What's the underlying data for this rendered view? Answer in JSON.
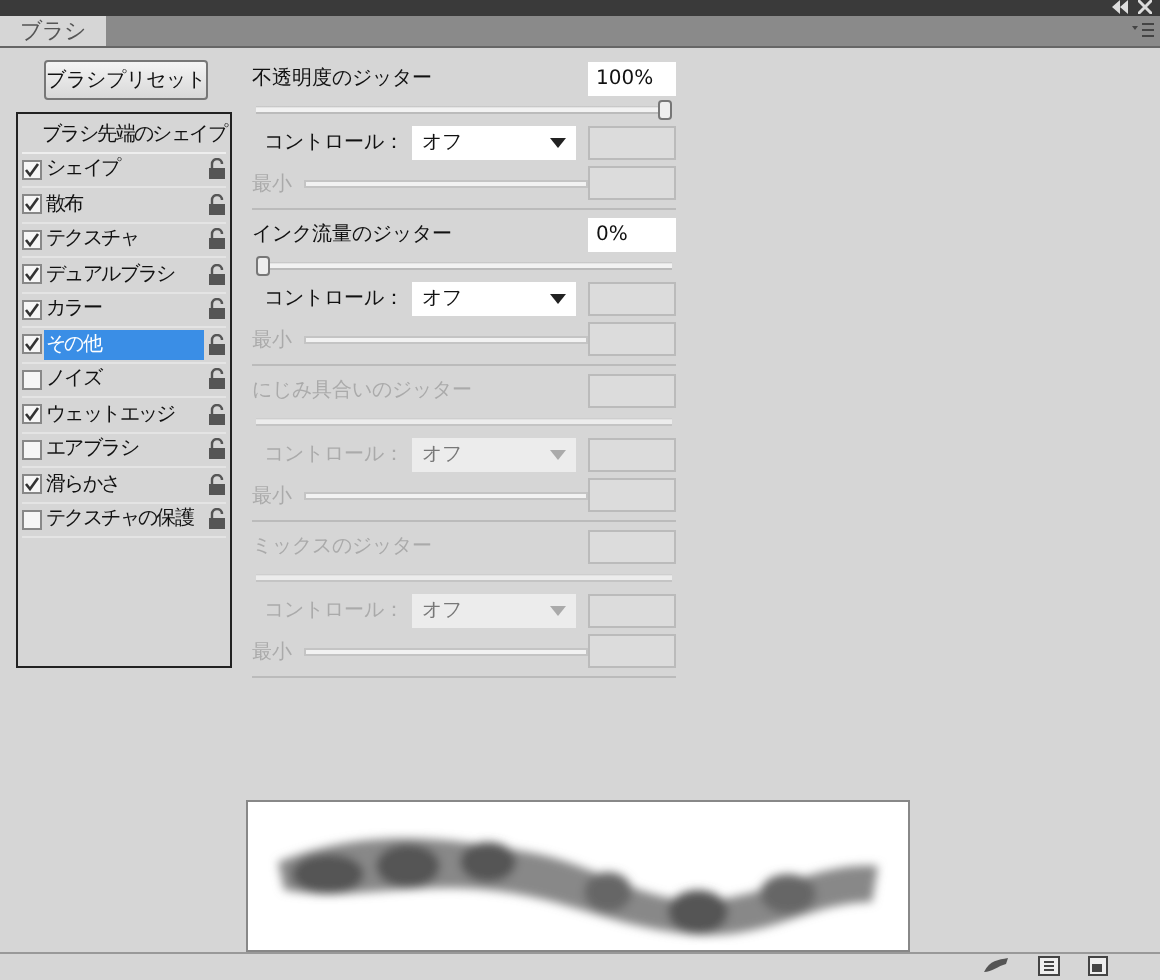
{
  "window": {
    "tab": "ブラシ"
  },
  "preset_button": "ブラシプリセット",
  "list": {
    "header": "ブラシ先端のシェイプ",
    "items": [
      {
        "label": "シェイプ",
        "checked": true,
        "selected": false
      },
      {
        "label": "散布",
        "checked": true,
        "selected": false
      },
      {
        "label": "テクスチャ",
        "checked": true,
        "selected": false
      },
      {
        "label": "デュアルブラシ",
        "checked": true,
        "selected": false
      },
      {
        "label": "カラー",
        "checked": true,
        "selected": false
      },
      {
        "label": "その他",
        "checked": true,
        "selected": true
      },
      {
        "label": "ノイズ",
        "checked": false,
        "selected": false
      },
      {
        "label": "ウェットエッジ",
        "checked": true,
        "selected": false
      },
      {
        "label": "エアブラシ",
        "checked": false,
        "selected": false
      },
      {
        "label": "滑らかさ",
        "checked": true,
        "selected": false
      },
      {
        "label": "テクスチャの保護",
        "checked": false,
        "selected": false
      }
    ]
  },
  "sections": [
    {
      "title": "不透明度のジッター",
      "value": "100%",
      "level": 1,
      "disabled": false,
      "control_label": "コントロール：",
      "control_value": "オフ",
      "min_label": "最小"
    },
    {
      "title": "インク流量のジッター",
      "value": "0%",
      "level": 0,
      "disabled": false,
      "control_label": "コントロール：",
      "control_value": "オフ",
      "min_label": "最小"
    },
    {
      "title": "にじみ具合いのジッター",
      "disabled": true,
      "control_label": "コントロール：",
      "control_value": "オフ",
      "min_label": "最小"
    },
    {
      "title": "ミックスのジッター",
      "disabled": true,
      "control_label": "コントロール：",
      "control_value": "オフ",
      "min_label": "最小"
    }
  ]
}
